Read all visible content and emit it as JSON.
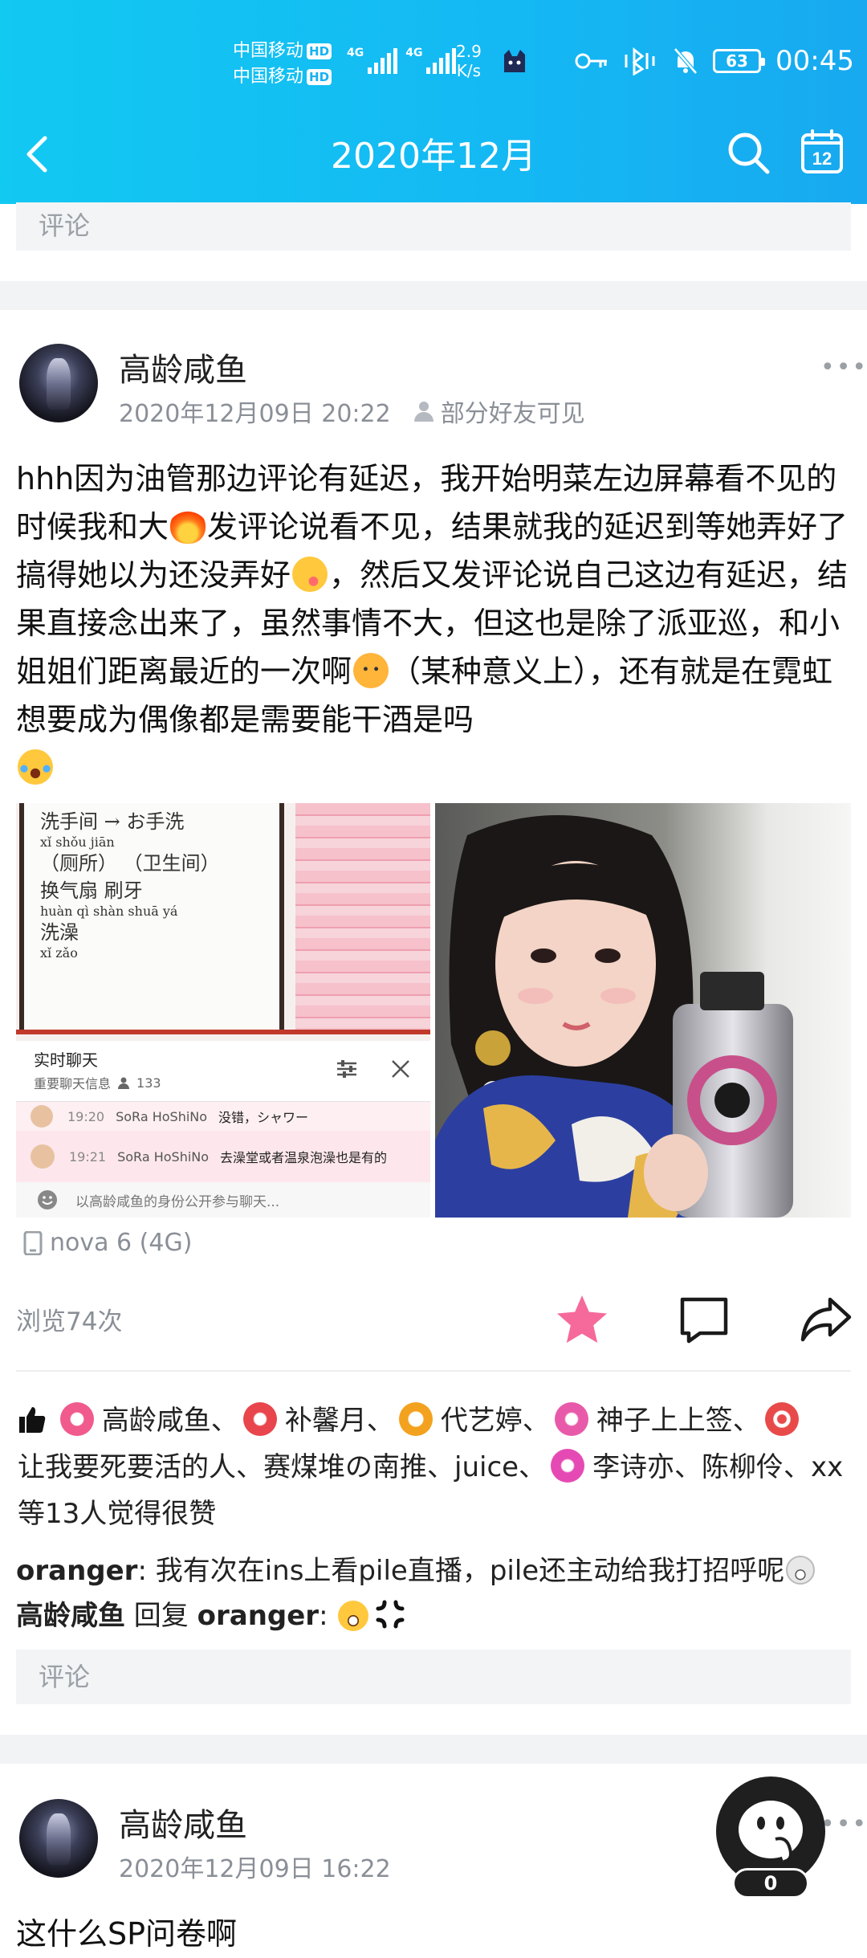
{
  "status_bar": {
    "carrier1": "中国移动",
    "carrier2": "中国移动",
    "hd": "HD",
    "net1": "4G",
    "net2": "4G",
    "speed_value": "2.9",
    "speed_unit": "K/s",
    "battery": "63",
    "time": "00:45"
  },
  "header": {
    "title": "2020年12月",
    "back_icon": "chevron-left-icon",
    "search_icon": "search-icon",
    "calendar_icon": "calendar-icon",
    "calendar_day": "12"
  },
  "comment_placeholder": "评论",
  "post": {
    "author": "高龄咸鱼",
    "datetime": "2020年12月09日 20:22",
    "visibility": "部分好友可见",
    "more": "•••",
    "text_parts": [
      "hhh因为油管那边评论有延迟，我开始明菜左边屏幕看不见的时候我和大",
      "发评论说看不见，结果就我的延迟到等她弄好了搞得她以为还没弄好",
      "，然后又发评论说自己这边有延迟，结果直接念出来了，虽然事情不大，但这也是除了派亚巡，和小姐姐们距离最近的一次啊",
      "（某种意义上），还有就是在霓虹想要成为偶像都是需要能干酒是吗"
    ],
    "image1": {
      "whiteboard_lines": [
        "洗手间 → お手洗",
        "xǐ shǒu jiān",
        "（厕所）  （卫生间）",
        "换气扇    刷牙",
        "huàn qì shàn  shuā yá",
        "洗澡",
        "xǐ zǎo"
      ],
      "chat_title": "实时聊天",
      "chat_subtitle": "重要聊天信息",
      "chat_count": "133",
      "messages": [
        {
          "time": "19:20",
          "user": "SoRa HoShiNo",
          "text": "没错，シャワー"
        },
        {
          "time": "19:21",
          "user": "SoRa HoShiNo",
          "text": "去澡堂或者温泉泡澡也是有的"
        }
      ],
      "input_placeholder": "以高龄咸鱼的身份公开参与聊天..."
    },
    "device": "nova 6 (4G)",
    "views": "浏览74次",
    "likes_users": [
      "高龄咸鱼、",
      "补馨月、",
      "代艺婷、",
      "神子上上签、",
      "让我要死要活的人、赛煤堆の南推、juice、",
      "李诗亦、陈柳伶、xx等13人觉得很赞"
    ],
    "comments": [
      {
        "author": "oranger",
        "sep": ": ",
        "text": "我有次在ins上看pile直播，pile还主动给我打招呼呢"
      },
      {
        "author": "高龄咸鱼",
        "reply_word": " 回复 ",
        "target": "oranger",
        "sep": ": "
      }
    ]
  },
  "post2": {
    "author": "高龄咸鱼",
    "datetime": "2020年12月09日 16:22",
    "text": "这什么SP问卷啊"
  },
  "fab": {
    "count": "0",
    "icon": "mascot-icon"
  },
  "colors": {
    "accent": "#14b8f3",
    "like_star": "#f56a9b"
  }
}
